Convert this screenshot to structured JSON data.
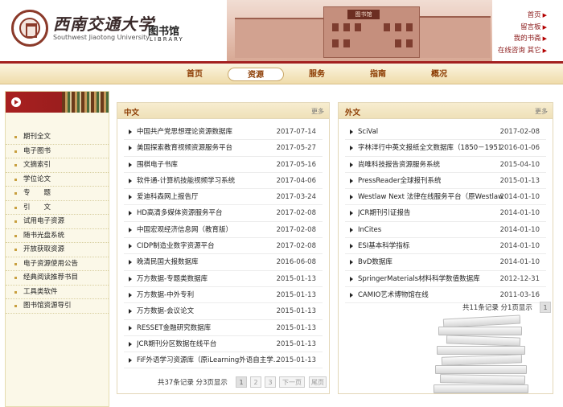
{
  "header": {
    "university_cn": "西南交通大学",
    "university_en": "Southwest Jiaotong University",
    "library_cn": "图书馆",
    "library_en": "LIBRARY",
    "building_sign": "图书馆",
    "top_links": [
      "首页",
      "留言板",
      "我的书斋",
      "在线咨询  其它"
    ]
  },
  "nav": {
    "items": [
      "首页",
      "资源",
      "服务",
      "指南",
      "概况"
    ],
    "active": "资源"
  },
  "sidebar": {
    "items": [
      "期刊全文",
      "电子图书",
      "文摘索引",
      "学位论文",
      "专　　题",
      "引　　文",
      "试用电子资源",
      "随书光盘系统",
      "开放获取资源",
      "电子资源使用公告",
      "经典阅读推荐书目",
      "工具类软件",
      "图书馆资源导引"
    ]
  },
  "panels": {
    "chinese": {
      "title": "中文",
      "more": "更多",
      "rows": [
        {
          "title": "中国共产党思想理论资源数据库",
          "date": "2017-07-14"
        },
        {
          "title": "美国探索教育视频资源服务平台",
          "date": "2017-05-27"
        },
        {
          "title": "围棋电子书库",
          "date": "2017-05-16"
        },
        {
          "title": "软件通-计算机技能视频学习系统",
          "date": "2017-04-06"
        },
        {
          "title": "爱迪科森网上报告厅",
          "date": "2017-03-24"
        },
        {
          "title": "HD高清多媒体资源服务平台",
          "date": "2017-02-08"
        },
        {
          "title": "中国宏观经济信息网（教育版）",
          "date": "2017-02-08"
        },
        {
          "title": "CIDP制造业数字资源平台",
          "date": "2017-02-08"
        },
        {
          "title": "晚清民国大报数据库",
          "date": "2016-06-08"
        },
        {
          "title": "万方数据-专题类数据库",
          "date": "2015-01-13"
        },
        {
          "title": "万方数据-中外专利",
          "date": "2015-01-13"
        },
        {
          "title": "万方数据-会议论文",
          "date": "2015-01-13"
        },
        {
          "title": "RESSET金融研究数据库",
          "date": "2015-01-13"
        },
        {
          "title": "JCR期刊分区数据在线平台",
          "date": "2015-01-13"
        },
        {
          "title": "FiF外语学习资源库（原iLearning外语自主学...",
          "date": "2015-01-13"
        }
      ],
      "pager_text": "共37条记录 分3页显示",
      "pages": [
        "1",
        "2",
        "3"
      ],
      "next": "下一页",
      "last": "尾页"
    },
    "foreign": {
      "title": "外文",
      "more": "更多",
      "rows": [
        {
          "title": "SciVal",
          "date": "2017-02-08"
        },
        {
          "title": "字林洋行中英文报纸全文数据库（1850－1951...",
          "date": "2016-01-06"
        },
        {
          "title": "尚唯科技报告资源服务系统",
          "date": "2015-04-10"
        },
        {
          "title": "PressReader全球报刊系统",
          "date": "2015-01-13"
        },
        {
          "title": "Westlaw Next 法律在线服务平台（原Westlaw...",
          "date": "2014-01-10"
        },
        {
          "title": "JCR期刊引证报告",
          "date": "2014-01-10"
        },
        {
          "title": "InCites",
          "date": "2014-01-10"
        },
        {
          "title": "ESI基本科学指标",
          "date": "2014-01-10"
        },
        {
          "title": "BvD数据库",
          "date": "2014-01-10"
        },
        {
          "title": "SpringerMaterials材料科学数值数据库",
          "date": "2012-12-31"
        },
        {
          "title": "CAMIO艺术博物馆在线",
          "date": "2011-03-16"
        }
      ],
      "pager_text": "共11条记录 分1页显示",
      "pages": [
        "1"
      ]
    }
  },
  "colors": {
    "brand_red": "#a32020",
    "nav_gold": "#efdcaa",
    "title_brown": "#8b3a00"
  }
}
